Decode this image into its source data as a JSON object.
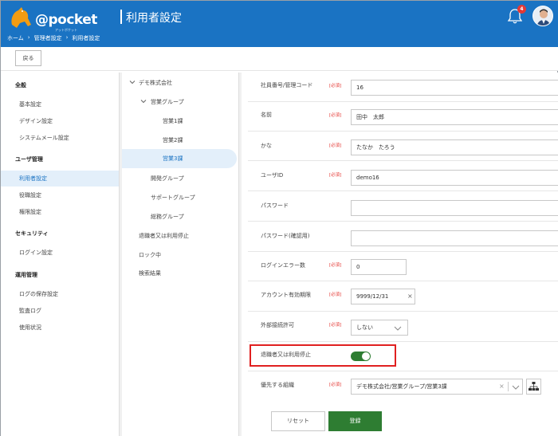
{
  "header": {
    "logo_text": "@pocket",
    "logo_sub": "アットポケット",
    "page_title": "利用者設定",
    "breadcrumb": [
      "ホーム",
      "›",
      "管理者設定",
      "›",
      "利用者設定"
    ],
    "notification_count": "4"
  },
  "toolbar": {
    "back_label": "戻る"
  },
  "sidebar": {
    "sections": [
      {
        "title": "全般",
        "items": [
          "基本設定",
          "デザイン設定",
          "システムメール設定"
        ]
      },
      {
        "title": "ユーザ管理",
        "items": [
          "利用者設定",
          "役職設定",
          "権限設定"
        ]
      },
      {
        "title": "セキュリティ",
        "items": [
          "ログイン設定"
        ]
      },
      {
        "title": "運用管理",
        "items": [
          "ログの保存設定",
          "監査ログ",
          "使用状況"
        ]
      }
    ],
    "active_item": "利用者設定"
  },
  "tree": {
    "root": "デモ株式会社",
    "group": "営業グループ",
    "sections": [
      "営業1課",
      "営業2課",
      "営業3課"
    ],
    "others": [
      "開発グループ",
      "サポートグループ",
      "総務グループ"
    ],
    "extras": [
      "退職者又は利用停止",
      "ロック中",
      "検索結果"
    ],
    "active_item": "営業3課"
  },
  "form": {
    "required_label": "[必須]",
    "employee_no": {
      "label": "社員番号/管理コード",
      "value": "16"
    },
    "name": {
      "label": "名前",
      "value": "田中　太郎"
    },
    "kana": {
      "label": "かな",
      "value": "たなか　たろう"
    },
    "user_id": {
      "label": "ユーザID",
      "value": "demo16"
    },
    "password": {
      "label": "パスワード",
      "value": ""
    },
    "password_confirm": {
      "label": "パスワード(確認用)",
      "value": ""
    },
    "login_errors": {
      "label": "ログインエラー数",
      "value": "0"
    },
    "expiry": {
      "label": "アカウント有効期限",
      "value": "9999/12/31",
      "clear": "×"
    },
    "external_access": {
      "label": "外部接続許可",
      "value": "しない"
    },
    "retired": {
      "label": "退職者又は利用停止",
      "state": "on"
    },
    "org": {
      "label": "優先する組織",
      "value": "デモ株式会社/営業グループ/営業3課",
      "clear": "×"
    }
  },
  "buttons": {
    "reset": "リセット",
    "submit": "登録"
  },
  "colors": {
    "brand": "#1a73c3",
    "green": "#2e7d32",
    "required": "#e53935",
    "highlight": "#e02020"
  }
}
